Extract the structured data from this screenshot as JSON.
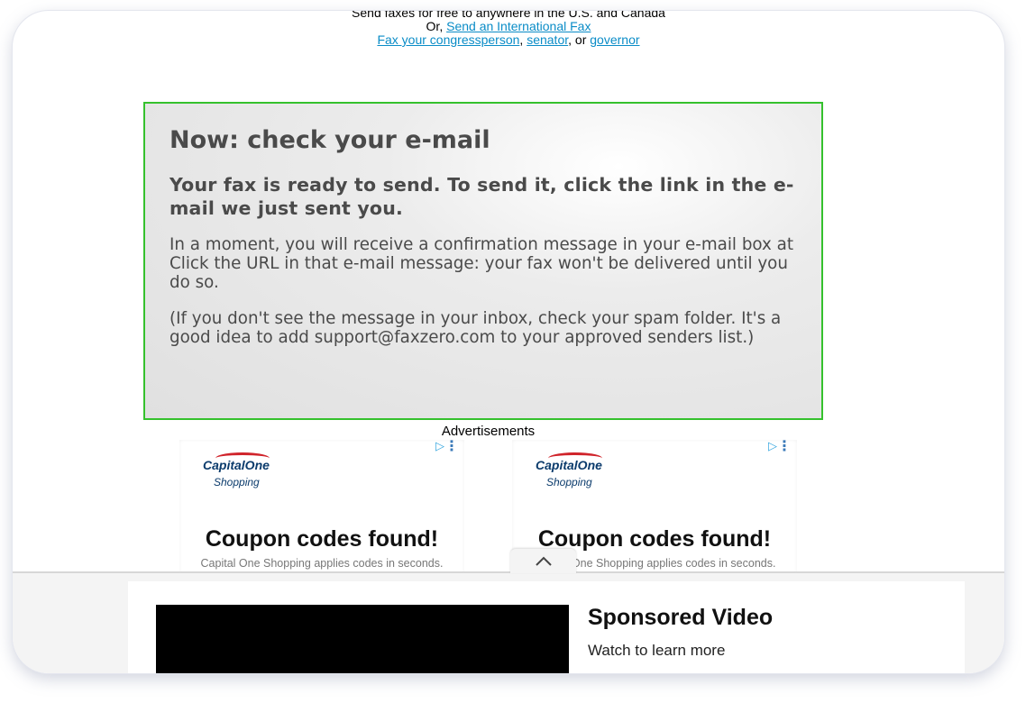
{
  "header": {
    "line1": "Send faxes for free to anywhere in the U.S. and Canada",
    "or_prefix": "Or, ",
    "intl_link": "Send an International Fax",
    "congress_link": "Fax your congressperson",
    "sep1": ", ",
    "senator_link": "senator",
    "sep2": ", or ",
    "governor_link": "governor"
  },
  "alert": {
    "title": "Now: check your e-mail",
    "subtitle": "Your fax is ready to send. To send it, click the link in the e-mail we just sent you.",
    "p1": " In a moment, you will receive a confirmation message in your e-mail box at",
    "p2": " Click the URL in that e-mail message: your fax won't be delivered until you do so.",
    "p3": "(If you don't see the message in your inbox, check your spam folder. It's a good idea to add support@faxzero.com to your approved senders list.)",
    "border_color": "#35c12d"
  },
  "ads": {
    "label": "Advertisements",
    "items": [
      {
        "brand": "CapitalOne",
        "brand_sub": "Shopping",
        "headline": "Coupon codes found!",
        "sub": "Capital One Shopping applies codes in seconds.",
        "adchoice_icon": "adchoices-icon",
        "menu_icon": "vertical-dots-icon"
      },
      {
        "brand": "CapitalOne",
        "brand_sub": "Shopping",
        "headline": "Coupon codes found!",
        "sub": "Capital One Shopping applies codes in seconds.",
        "adchoice_icon": "adchoices-icon",
        "menu_icon": "vertical-dots-icon"
      }
    ]
  },
  "video": {
    "title": "Sponsored Video",
    "subtitle": "Watch to learn more",
    "collapse_icon": "chevron-up-icon"
  }
}
